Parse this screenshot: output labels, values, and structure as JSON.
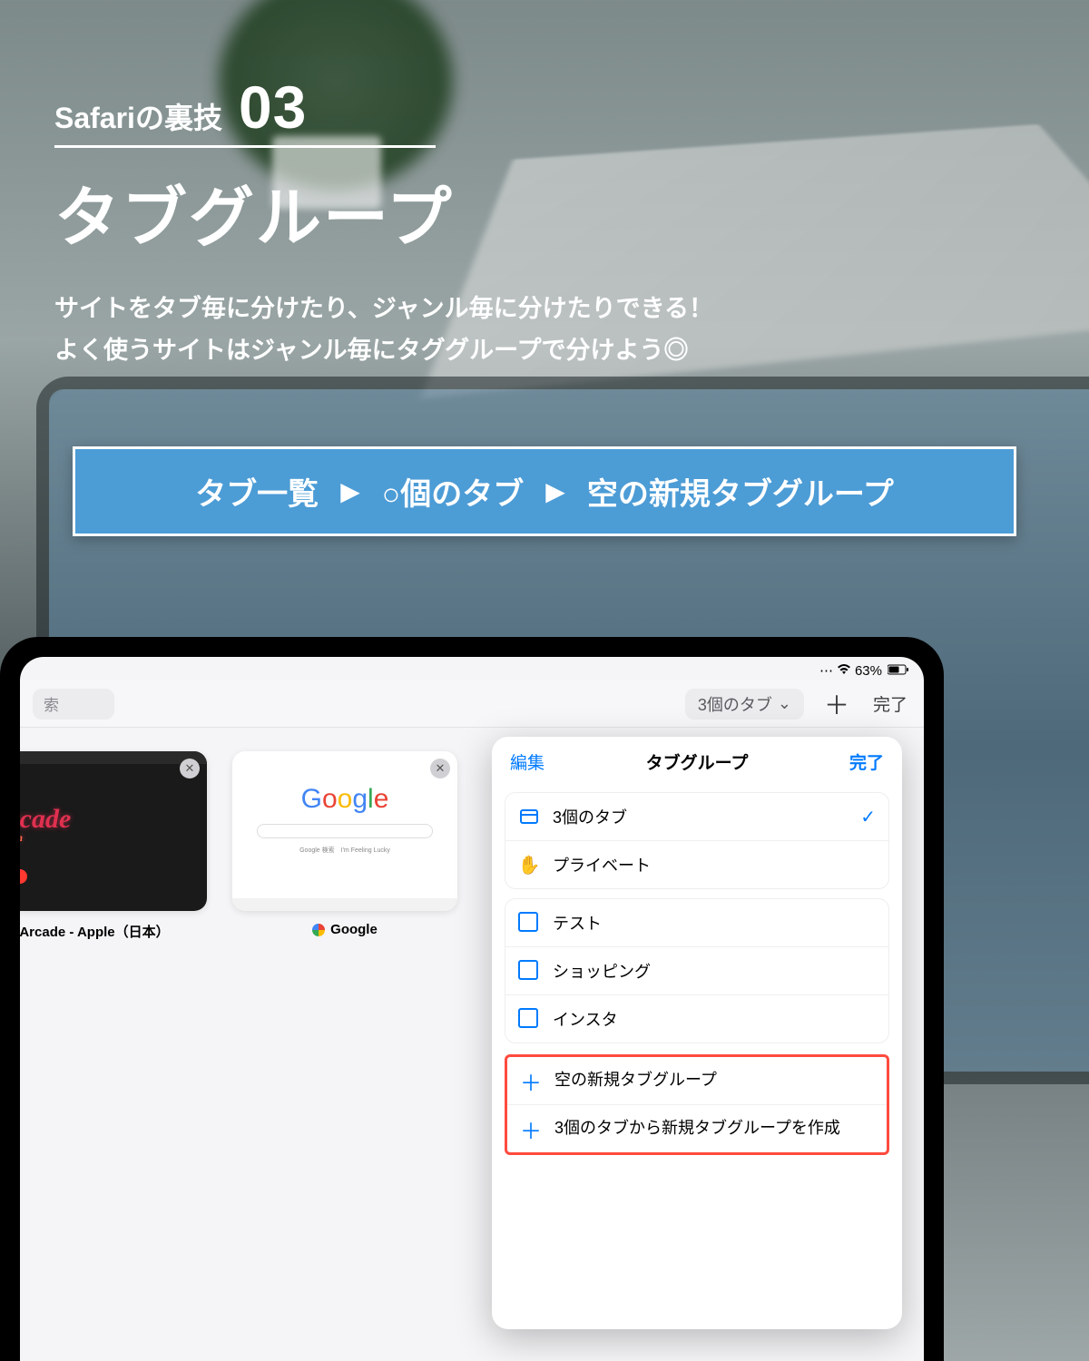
{
  "header": {
    "subtitle": "Safariの裏技",
    "number": "03",
    "title": "タブグループ",
    "desc_line1": "サイトをタブ毎に分けたり、ジャンル毎に分けたりできる！",
    "desc_line2": "よく使うサイトはジャンル毎にタググループで分けよう◎"
  },
  "steps": {
    "s1": "タブ一覧",
    "s2": "○個のタブ",
    "s3": "空の新規タブグループ"
  },
  "status": {
    "battery_pct": "63%"
  },
  "toolbar": {
    "search_placeholder": "索",
    "tab_dropdown": "3個のタブ",
    "plus": "＋",
    "done": "完了"
  },
  "tabs": [
    {
      "title": "Arcade - Apple（日本）",
      "thumb_label": "Arcade",
      "thumb_sub": "is open"
    },
    {
      "title": "Google",
      "thumb_label": "Google",
      "thumb_sub": "Google 検索　I'm Feeling Lucky"
    }
  ],
  "popover": {
    "edit": "編集",
    "title": "タブグループ",
    "done": "完了",
    "primary": [
      {
        "label": "3個のタブ",
        "checked": true,
        "icon": "window"
      },
      {
        "label": "プライベート",
        "checked": false,
        "icon": "hand"
      }
    ],
    "groups": [
      {
        "label": "テスト"
      },
      {
        "label": "ショッピング"
      },
      {
        "label": "インスタ"
      }
    ],
    "actions": [
      {
        "label": "空の新規タブグループ"
      },
      {
        "label": "3個のタブから新規タブグループを作成"
      }
    ]
  }
}
